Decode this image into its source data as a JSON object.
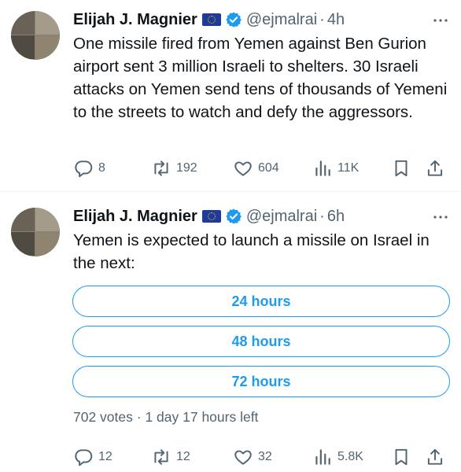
{
  "tweets": [
    {
      "author": {
        "name": "Elijah J. Magnier",
        "handle": "@ejmalrai",
        "time": "4h"
      },
      "text": "One missile fired from Yemen against Ben Gurion airport sent 3 million Israeli to shelters. 30 Israeli attacks on Yemen send tens of thousands of Yemeni to the streets to watch and defy the aggressors.",
      "stats": {
        "replies": "8",
        "reposts": "192",
        "likes": "604",
        "views": "11K"
      }
    },
    {
      "author": {
        "name": "Elijah J. Magnier",
        "handle": "@ejmalrai",
        "time": "6h"
      },
      "text": "Yemen is expected to launch a missile on Israel in the next:",
      "poll": {
        "options": [
          "24 hours",
          "48 hours",
          "72 hours"
        ],
        "meta": "702 votes · 1 day 17 hours left"
      },
      "stats": {
        "replies": "12",
        "reposts": "12",
        "likes": "32",
        "views": "5.8K"
      }
    }
  ],
  "colors": {
    "accent": "#1d9bf0",
    "muted": "#536471",
    "text": "#0f1419",
    "divider": "#eff3f4"
  },
  "icons": [
    "reply-icon",
    "repost-icon",
    "like-icon",
    "views-icon",
    "bookmark-icon",
    "share-icon",
    "more-icon",
    "verified-badge-icon",
    "eu-flag-icon"
  ]
}
